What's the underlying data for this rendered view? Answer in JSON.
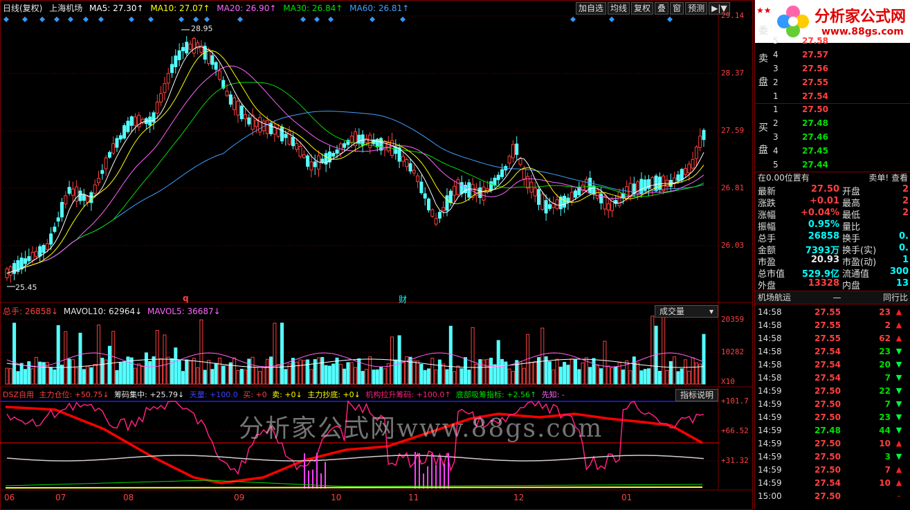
{
  "legend": {
    "title": "日线(复权)",
    "stock": "上海机场",
    "ma": [
      {
        "label": "MA5: 27.30↑",
        "color": "#ffffff"
      },
      {
        "label": "MA10: 27.07↑",
        "color": "#ffff00"
      },
      {
        "label": "MA20: 26.90↑",
        "color": "#ff66ff"
      },
      {
        "label": "MA30: 26.84↑",
        "color": "#00e000"
      },
      {
        "label": "MA60: 26.81↑",
        "color": "#40a0ff"
      }
    ]
  },
  "toolbar": {
    "btn1": "加自选",
    "btn2": "均线",
    "btn3": "复权",
    "btn4": "叠",
    "btn5": "窗",
    "btn6": "预测",
    "btn7": "▶|▼"
  },
  "price_axis": {
    "l1": "29.14",
    "l2": "28.37",
    "l3": "27.59",
    "l4": "26.81",
    "l5": "26.03"
  },
  "price_marks": {
    "high": "28.95",
    "low": "25.45",
    "mark_q": "q",
    "mark_cai": "财"
  },
  "volume": {
    "label": "总手: 26858↓",
    "mavol10": "MAVOL10: 62964↓",
    "mavol5": "MAVOL5: 36687↓",
    "button": "成交量",
    "axis_top": "20359",
    "axis_mid": "10282",
    "axis_unit": "X10"
  },
  "indicator": {
    "name": "DSZ自用",
    "i1": "主力仓位: +50.75↓",
    "i2": "筹码集中: +25.79↓",
    "i3": "天量: +100.0",
    "i4": "买: +0",
    "i5": "卖: +0↓",
    "i6": "主力抄底: +0↓",
    "i7": "机构拉升筹码: +100.0↑",
    "i8": "底部吸筹指标: +2.56↑",
    "i9": "先知: -",
    "button": "指标说明",
    "axis_a": "+101.7",
    "axis_b": "+66.52",
    "axis_c": "+31.32"
  },
  "xaxis": {
    "m06": "06",
    "m07": "07",
    "m08": "08",
    "m09": "09",
    "m10": "10",
    "m11": "11",
    "m12": "12",
    "m01": "01"
  },
  "watermark": "分析家公式网www.88gs.com",
  "logo": {
    "text": "分析家公式网",
    "url": "www.88gs.com",
    "stars": "★★"
  },
  "orderbook": {
    "sell_label_1": "委",
    "sell_label_2": "卖",
    "sell_label_3": "盘",
    "buy_label_1": "买",
    "buy_label_2": "盘",
    "sell": [
      {
        "lv": "5",
        "px": "27.58"
      },
      {
        "lv": "4",
        "px": "27.57"
      },
      {
        "lv": "3",
        "px": "27.56"
      },
      {
        "lv": "2",
        "px": "27.55"
      },
      {
        "lv": "1",
        "px": "27.54"
      }
    ],
    "buy": [
      {
        "lv": "1",
        "px": "27.50"
      },
      {
        "lv": "2",
        "px": "27.48"
      },
      {
        "lv": "3",
        "px": "27.46"
      },
      {
        "lv": "4",
        "px": "27.45"
      },
      {
        "lv": "5",
        "px": "27.44"
      }
    ]
  },
  "quote": {
    "header_left": "在0.00位置有",
    "header_right": "卖单! 查看",
    "rows": [
      {
        "k1": "最新",
        "v1": "27.50",
        "k2": "开盘",
        "v2": "2"
      },
      {
        "k1": "涨跌",
        "v1": "+0.01",
        "k2": "最高",
        "v2": "2"
      },
      {
        "k1": "涨幅",
        "v1": "+0.04%",
        "k2": "最低",
        "v2": "2"
      },
      {
        "k1": "振幅",
        "v1": "0.95%",
        "k2": "量比",
        "v2": ""
      },
      {
        "k1": "总手",
        "v1": "26858",
        "k2": "换手",
        "v2": "0."
      },
      {
        "k1": "金额",
        "v1": "7393万",
        "k2": "换手(实)",
        "v2": "0."
      },
      {
        "k1": "市盈",
        "v1": "20.93",
        "k2": "市盈(动)",
        "v2": "1"
      },
      {
        "k1": "总市值",
        "v1": "529.9亿",
        "k2": "流通值",
        "v2": "300"
      },
      {
        "k1": "外盘",
        "v1": "13328",
        "k2": "内盘",
        "v2": "13"
      }
    ]
  },
  "ticks": {
    "section_left": "机场航运",
    "section_mid": "—",
    "section_right": "同行比",
    "rows": [
      {
        "t": "14:58",
        "p": "27.55",
        "v": "23",
        "dir": "up"
      },
      {
        "t": "14:58",
        "p": "27.55",
        "v": "2",
        "dir": "up"
      },
      {
        "t": "14:58",
        "p": "27.55",
        "v": "62",
        "dir": "up"
      },
      {
        "t": "14:58",
        "p": "27.54",
        "v": "23",
        "dir": "down"
      },
      {
        "t": "14:58",
        "p": "27.54",
        "v": "20",
        "dir": "down"
      },
      {
        "t": "14:58",
        "p": "27.54",
        "v": "7",
        "dir": "down"
      },
      {
        "t": "14:59",
        "p": "27.50",
        "v": "22",
        "dir": "down"
      },
      {
        "t": "14:59",
        "p": "27.50",
        "v": "7",
        "dir": "down"
      },
      {
        "t": "14:59",
        "p": "27.50",
        "v": "23",
        "dir": "down"
      },
      {
        "t": "14:59",
        "p": "27.48",
        "v": "44",
        "dir": "down"
      },
      {
        "t": "14:59",
        "p": "27.50",
        "v": "10",
        "dir": "up"
      },
      {
        "t": "14:59",
        "p": "27.50",
        "v": "3",
        "dir": "down"
      },
      {
        "t": "14:59",
        "p": "27.50",
        "v": "7",
        "dir": "up"
      },
      {
        "t": "14:59",
        "p": "27.54",
        "v": "10",
        "dir": "up"
      },
      {
        "t": "15:00",
        "p": "27.50",
        "v": "",
        "dir": "none"
      }
    ]
  },
  "colors": {
    "up": "#ff4040",
    "down": "#00ffff",
    "frame": "#800000",
    "accent_red": "#ff0000",
    "pink": "#ff2080"
  }
}
